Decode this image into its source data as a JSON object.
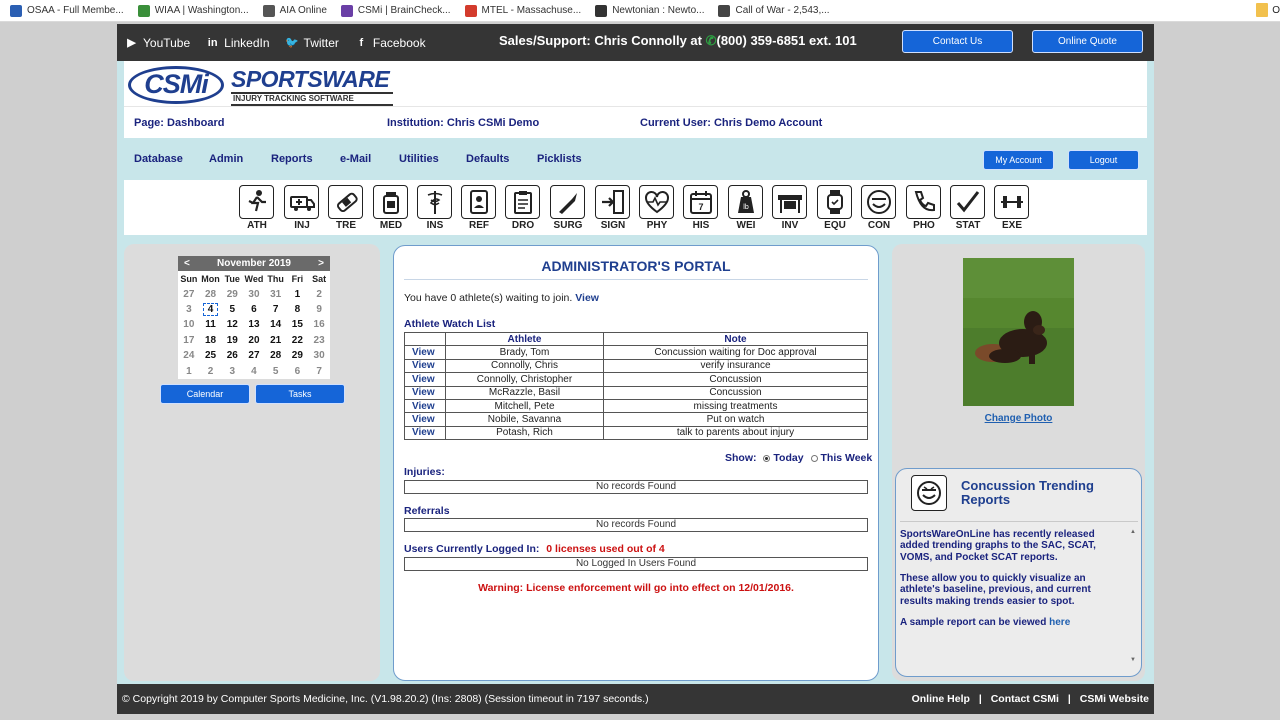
{
  "bookmarks": [
    {
      "label": "OSAA - Full Membe...",
      "icon": "osaa-icon",
      "color": "#2b5fb3"
    },
    {
      "label": "WIAA | Washington...",
      "icon": "wiaa-icon",
      "color": "#3a8f3a"
    },
    {
      "label": "AIA Online",
      "icon": "globe-icon",
      "color": "#555555"
    },
    {
      "label": "CSMi | BrainCheck...",
      "icon": "csmi-icon",
      "color": "#6a3fa6"
    },
    {
      "label": "MTEL - Massachuse...",
      "icon": "chrome-icon",
      "color": "#d33b2c"
    },
    {
      "label": "Newtonian : Newto...",
      "icon": "newspaper-icon",
      "color": "#333333"
    },
    {
      "label": "Call of War - 2,543,...",
      "icon": "gear-icon",
      "color": "#444444"
    }
  ],
  "bookmarks_more_label": "O",
  "topbar": {
    "social": [
      {
        "label": "YouTube",
        "icon": "youtube-icon",
        "glyph": "▶"
      },
      {
        "label": "LinkedIn",
        "icon": "linkedin-icon",
        "glyph": "in"
      },
      {
        "label": "Twitter",
        "icon": "twitter-icon",
        "glyph": "🐦"
      },
      {
        "label": "Facebook",
        "icon": "facebook-icon",
        "glyph": "f"
      }
    ],
    "sales_prefix": "Sales/Support: Chris Connolly at ",
    "sales_phone": "(800) 359-6851 ext. 101",
    "contact_us": "Contact Us",
    "online_quote": "Online Quote"
  },
  "logo": {
    "csmi": "CSMi",
    "sports": "SPORTS",
    "ware": "WARE",
    "tagline": "INJURY TRACKING SOFTWARE"
  },
  "info": {
    "page": "Page: Dashboard",
    "institution": "Institution: Chris CSMi Demo",
    "user": "Current User: Chris Demo Account"
  },
  "nav": {
    "items": [
      "Database",
      "Admin",
      "Reports",
      "e-Mail",
      "Utilities",
      "Defaults",
      "Picklists"
    ],
    "my_account": "My Account",
    "logout": "Logout"
  },
  "modules": [
    {
      "label": "ATH",
      "icon": "running-athlete-icon"
    },
    {
      "label": "INJ",
      "icon": "ambulance-icon"
    },
    {
      "label": "TRE",
      "icon": "bandage-icon"
    },
    {
      "label": "MED",
      "icon": "medicine-bottle-icon"
    },
    {
      "label": "INS",
      "icon": "caduceus-icon"
    },
    {
      "label": "REF",
      "icon": "id-card-icon"
    },
    {
      "label": "DRO",
      "icon": "clipboard-icon"
    },
    {
      "label": "SURG",
      "icon": "scalpel-icon"
    },
    {
      "label": "SIGN",
      "icon": "sign-in-icon"
    },
    {
      "label": "PHY",
      "icon": "heart-pulse-icon"
    },
    {
      "label": "HIS",
      "icon": "calendar-icon"
    },
    {
      "label": "WEI",
      "icon": "weight-icon"
    },
    {
      "label": "INV",
      "icon": "shelf-icon"
    },
    {
      "label": "EQU",
      "icon": "smartwatch-icon"
    },
    {
      "label": "CON",
      "icon": "concussion-head-icon"
    },
    {
      "label": "PHO",
      "icon": "phone-icon"
    },
    {
      "label": "STAT",
      "icon": "checkmark-icon"
    },
    {
      "label": "EXE",
      "icon": "dumbbell-icon"
    }
  ],
  "calendar": {
    "month": "November 2019",
    "prev": "<",
    "next": ">",
    "days": [
      "Sun",
      "Mon",
      "Tue",
      "Wed",
      "Thu",
      "Fri",
      "Sat"
    ],
    "weeks": [
      [
        "27",
        "28",
        "29",
        "30",
        "31",
        "1",
        "2"
      ],
      [
        "3",
        "4",
        "5",
        "6",
        "7",
        "8",
        "9"
      ],
      [
        "10",
        "11",
        "12",
        "13",
        "14",
        "15",
        "16"
      ],
      [
        "17",
        "18",
        "19",
        "20",
        "21",
        "22",
        "23"
      ],
      [
        "24",
        "25",
        "26",
        "27",
        "28",
        "29",
        "30"
      ],
      [
        "1",
        "2",
        "3",
        "4",
        "5",
        "6",
        "7"
      ]
    ],
    "selected": "4",
    "calendar_btn": "Calendar",
    "tasks_btn": "Tasks"
  },
  "portal": {
    "title": "ADMINISTRATOR'S PORTAL",
    "waiting_text": "You have 0 athlete(s) waiting to join.",
    "waiting_link": "View",
    "watch_title": "Athlete Watch List",
    "col_athlete": "Athlete",
    "col_note": "Note",
    "rows": [
      {
        "view": "View",
        "athlete": "Brady, Tom",
        "note": "Concussion waiting for Doc approval"
      },
      {
        "view": "View",
        "athlete": "Connolly, Chris",
        "note": "verify insurance"
      },
      {
        "view": "View",
        "athlete": "Connolly, Christopher",
        "note": "Concussion"
      },
      {
        "view": "View",
        "athlete": "McRazzle, Basil",
        "note": "Concussion"
      },
      {
        "view": "View",
        "athlete": "Mitchell, Pete",
        "note": "missing treatments"
      },
      {
        "view": "View",
        "athlete": "Nobile, Savanna",
        "note": "Put on watch"
      },
      {
        "view": "View",
        "athlete": "Potash, Rich",
        "note": "talk to parents about injury"
      }
    ],
    "show_label": "Show:",
    "today": "Today",
    "this_week": "This Week",
    "injuries_label": "Injuries:",
    "injuries_empty": "No records Found",
    "referrals_label": "Referrals",
    "referrals_empty": "No records Found",
    "logged_label": "Users Currently Logged In:",
    "logged_count": "0 licenses used out of 4",
    "logged_empty": "No Logged In Users Found",
    "warning": "Warning: License enforcement will go into effect on 12/01/2016."
  },
  "right": {
    "change_photo": "Change Photo",
    "trend_title": "Concussion Trending Reports",
    "trend_p1": "SportsWareOnLine has recently released added trending graphs to the SAC, SCAT, VOMS, and Pocket SCAT reports.",
    "trend_p2": "These allow you to quickly visualize an athlete's baseline, previous, and current results making trends easier to spot.",
    "trend_p3": "A sample report can be viewed ",
    "trend_link": "here"
  },
  "footer": {
    "copyright": "© Copyright 2019 by Computer Sports Medicine, Inc. (V1.98.20.2) (Ins: 2808) (Session timeout in 7197 seconds.)",
    "help": "Online Help",
    "contact": "Contact CSMi",
    "website": "CSMi Website",
    "sep": "|"
  },
  "colors": {
    "accent": "#1565d8",
    "navy": "#1a237e",
    "warning": "#cc1111",
    "topbar": "#353535"
  }
}
